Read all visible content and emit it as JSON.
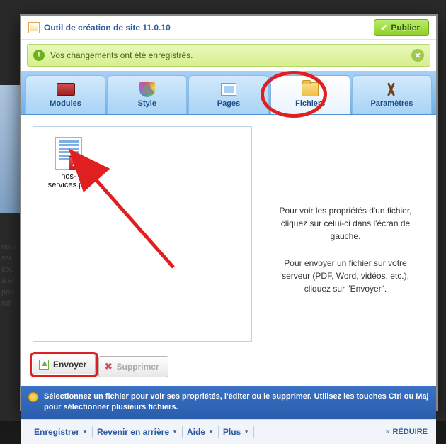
{
  "title": "Outil de création de site 11.0.10",
  "publish_label": "Publier",
  "notice": {
    "text": "Vos changements ont été enregistrés."
  },
  "tabs": [
    {
      "label": "Modules"
    },
    {
      "label": "Style"
    },
    {
      "label": "Pages"
    },
    {
      "label": "Fichiers"
    },
    {
      "label": "Paramètres"
    }
  ],
  "active_tab_index": 3,
  "files": [
    {
      "name": "nos-services.pdf"
    }
  ],
  "info": {
    "p1": "Pour voir les propriétés d'un fichier, cliquez sur celui-ci dans l'écran de gauche.",
    "p2": "Pour envoyer un fichier sur votre serveur (PDF, Word, vidéos, etc.), cliquez sur \"Envoyer\"."
  },
  "actions": {
    "send": "Envoyer",
    "delete": "Supprimer"
  },
  "tip": "Sélectionnez un fichier pour voir ses propriétés, l'éditer ou le supprimer. Utilisez les touches Ctrl ou Maj pour sélectionner plusieurs fichiers.",
  "footer": {
    "save": "Enregistrer",
    "revert": "Revenir en arrière",
    "help": "Aide",
    "more": "Plus",
    "reduce": "RÉDUIRE"
  },
  "colors": {
    "highlight": "#e02020",
    "primary_blue": "#2c5aa0",
    "tab_bg": "#a6d0f7"
  }
}
